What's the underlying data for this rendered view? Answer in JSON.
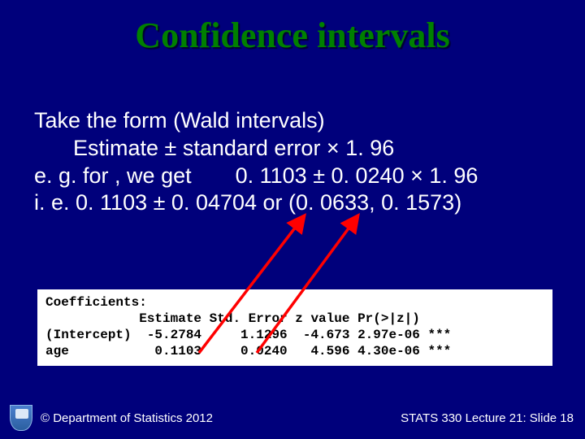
{
  "title": "Confidence intervals",
  "lines": {
    "l1": "Take the form (Wald intervals)",
    "l2": "Estimate  ±  standard error × 1. 96",
    "l3a": "e. g. for , we get",
    "l3b": "0. 1103 ± 0. 0240 × 1. 96",
    "l4": "i. e. 0. 1103 ± 0. 04704 or  (0. 0633, 0. 1573)"
  },
  "coef": {
    "h": "Coefficients:",
    "hdr": "            Estimate Std. Error z value Pr(>|z|)",
    "r1": "(Intercept)  -5.2784     1.1296  -4.673 2.97e-06 ***",
    "r2": "age           0.1103     0.0240   4.596 4.30e-06 ***"
  },
  "footer": {
    "left": "© Department of Statistics 2012",
    "right": "STATS 330 Lecture 21: Slide 18"
  },
  "chart_data": {
    "type": "table",
    "title": "Coefficients",
    "columns": [
      "",
      "Estimate",
      "Std. Error",
      "z value",
      "Pr(>|z|)",
      ""
    ],
    "rows": [
      [
        "(Intercept)",
        -5.2784,
        1.1296,
        -4.673,
        "2.97e-06",
        "***"
      ],
      [
        "age",
        0.1103,
        0.024,
        4.596,
        "4.30e-06",
        "***"
      ]
    ]
  }
}
